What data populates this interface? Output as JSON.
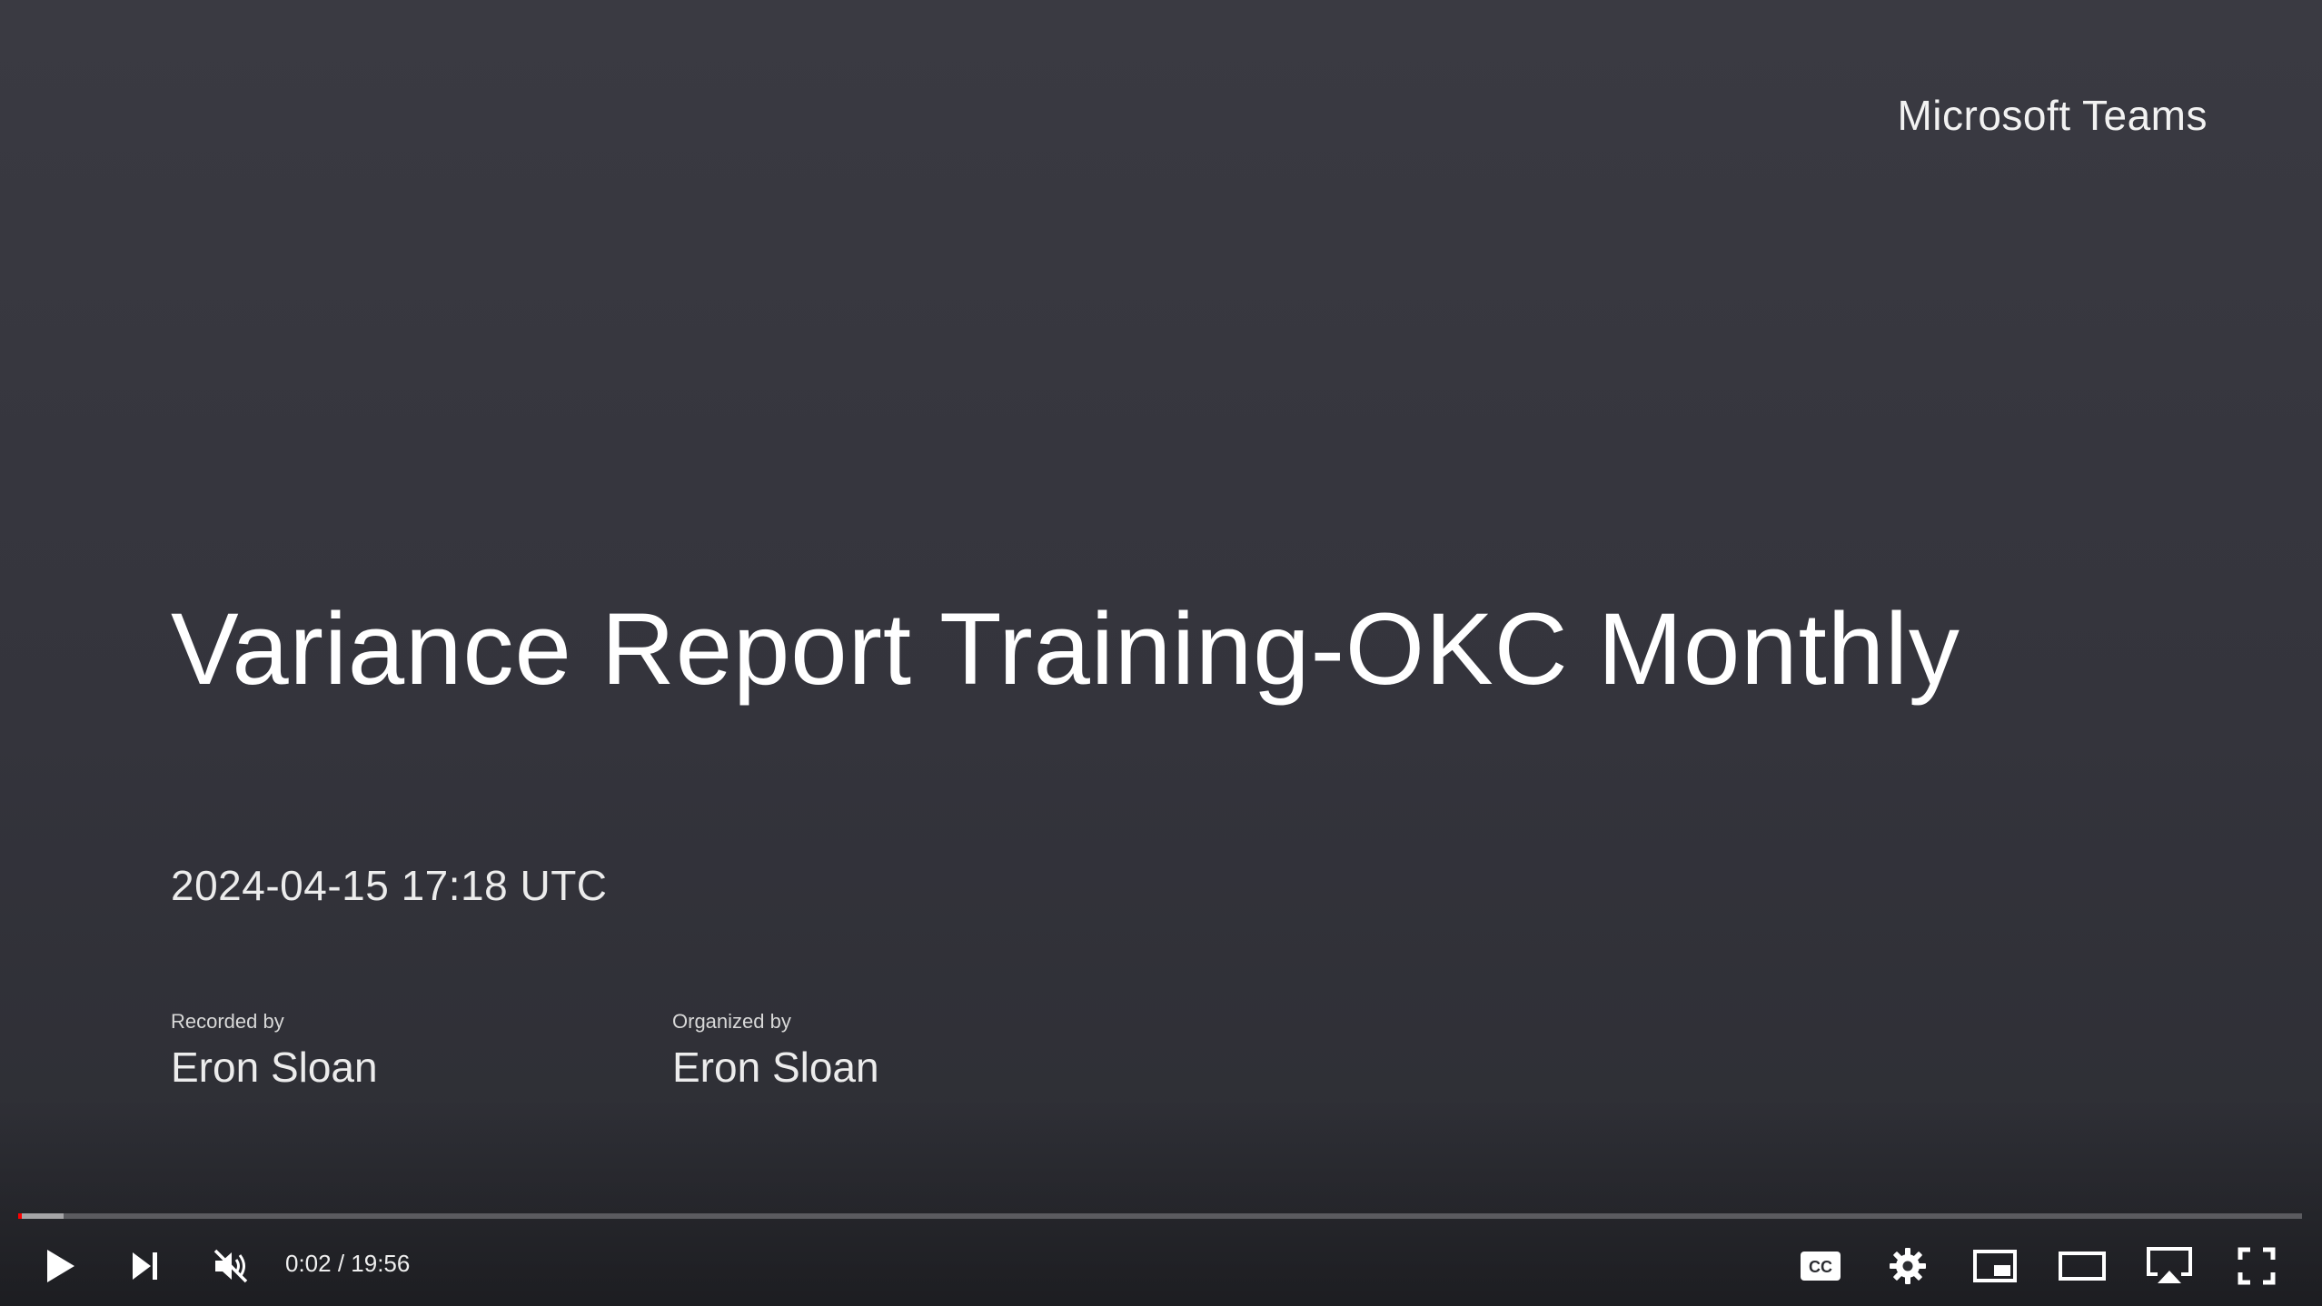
{
  "slide": {
    "brand": "Microsoft Teams",
    "title": "Variance Report Training-OKC Monthly",
    "datetime": "2024-04-15 17:18 UTC",
    "recorded_label": "Recorded by",
    "recorded_name": "Eron Sloan",
    "organized_label": "Organized by",
    "organized_name": "Eron Sloan"
  },
  "player": {
    "current_time": "0:02",
    "separator": " / ",
    "duration": "19:56",
    "progress_fraction": 0.0017,
    "buffered_fraction": 0.02,
    "icons": {
      "play": "play-icon",
      "next": "skip-next-icon",
      "mute": "volume-muted-icon",
      "captions": "cc-icon",
      "settings": "gear-icon",
      "miniplayer": "miniplayer-icon",
      "theater": "theater-mode-icon",
      "cast": "airplay-icon",
      "fullscreen": "fullscreen-icon"
    },
    "colors": {
      "progress": "#ff0000",
      "icon": "#ffffff"
    }
  }
}
